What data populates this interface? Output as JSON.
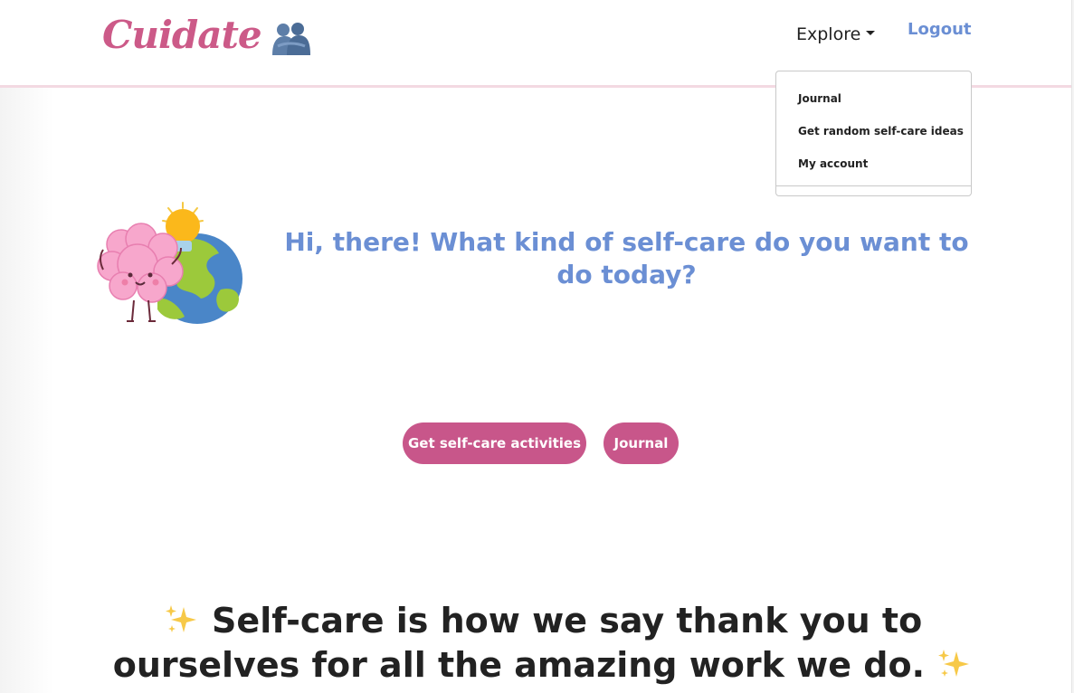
{
  "navbar": {
    "brand": "Cuidate",
    "brand_icon": "hug-emoji-icon",
    "explore_label": "Explore",
    "logout_label": "Logout"
  },
  "dropdown": {
    "items": [
      {
        "label": "Journal"
      },
      {
        "label": "Get random self-care ideas"
      },
      {
        "label": "My account"
      }
    ]
  },
  "hero": {
    "illustration": "brain-and-earth-illustration",
    "title": "Hi, there! What kind of self-care do you want to do today?"
  },
  "buttons": {
    "activities_label": "Get self-care activities",
    "journal_label": "Journal"
  },
  "quote": {
    "text": "Self-care is how we say thank you to ourselves for all the amazing work we do.",
    "icon": "sparkles-icon"
  },
  "colors": {
    "brand_pink": "#cc5a88",
    "button_pink": "#c8568a",
    "link_blue": "#6b8fd4",
    "divider_pink": "#f3d9e2"
  }
}
